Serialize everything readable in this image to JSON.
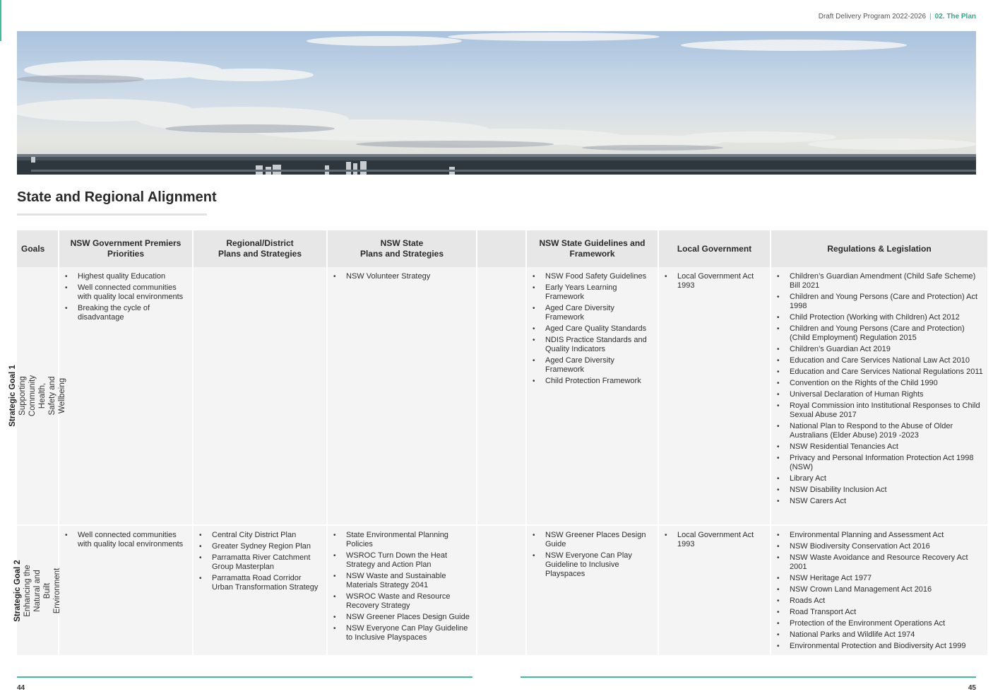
{
  "header": {
    "document_title": "Draft Delivery Program 2022-2026",
    "separator": "|",
    "section": "02. The Plan"
  },
  "banner": {
    "description_icon": "skyline-photo"
  },
  "page_title": "State and Regional Alignment",
  "table": {
    "headers": [
      "Goals",
      "NSW Government Premiers\nPriorities",
      "Regional/District\nPlans and Strategies",
      "NSW State\nPlans and Strategies",
      "",
      "NSW State Guidelines and\nFramework",
      "Local Government",
      "Regulations & Legislation"
    ],
    "rows": [
      {
        "goal_number": "Strategic Goal 1",
        "goal_name": "Supporting Community Health,\nSafety and Wellbeing",
        "premiers_priorities": [
          "Highest quality Education",
          "Well connected communities with quality local environments",
          "Breaking the cycle of disadvantage"
        ],
        "regional_plans": [],
        "state_plans": [
          "NSW Volunteer Strategy"
        ],
        "blank": [],
        "state_guidelines": [
          "NSW Food Safety Guidelines",
          "Early Years Learning Framework",
          "Aged Care Diversity Framework",
          "Aged Care Quality Standards",
          "NDIS Practice Standards and Quality Indicators",
          "Aged Care Diversity Framework",
          "Child Protection Framework"
        ],
        "local_government": [
          "Local Government Act 1993"
        ],
        "legislation": [
          "Children’s Guardian Amendment (Child Safe Scheme) Bill 2021",
          "Children and Young Persons (Care and Protection) Act 1998",
          "Child Protection (Working with Children) Act 2012",
          "Children and Young Persons (Care and Protection) (Child Employment) Regulation 2015",
          "Children’s Guardian Act 2019",
          "Education and Care Services National Law Act 2010",
          "Education and Care Services National Regulations 2011",
          "Convention on the Rights of the Child 1990",
          "Universal Declaration of Human Rights",
          "Royal Commission into Institutional Responses to Child Sexual Abuse 2017",
          "National Plan to Respond to the Abuse of Older Australians (Elder Abuse) 2019 -2023",
          "NSW Residential Tenancies Act",
          "Privacy and Personal Information Protection Act 1998 (NSW)",
          "Library Act",
          "NSW Disability Inclusion Act",
          "NSW Carers Act"
        ]
      },
      {
        "goal_number": "Strategic Goal 2",
        "goal_name": "Enhancing the Natural and\nBuilt Environment",
        "premiers_priorities": [
          "Well connected communities with quality local environments"
        ],
        "regional_plans": [
          "Central City District Plan",
          "Greater Sydney Region Plan",
          "Parramatta River Catchment Group Masterplan",
          "Parramatta Road Corridor Urban Transformation Strategy"
        ],
        "state_plans": [
          "State Environmental Planning Policies",
          "WSROC Turn Down the Heat Strategy and Action Plan",
          "NSW Waste and Sustainable Materials Strategy 2041",
          "WSROC Waste and Resource Recovery Strategy",
          "NSW Greener Places Design Guide",
          "NSW Everyone Can Play Guideline to Inclusive Playspaces"
        ],
        "blank": [],
        "state_guidelines": [
          "NSW Greener Places Design Guide",
          "NSW Everyone Can Play Guideline to Inclusive Playspaces"
        ],
        "local_government": [
          "Local Government Act 1993"
        ],
        "legislation": [
          "Environmental Planning and Assessment Act",
          "NSW Biodiversity Conservation Act 2016",
          "NSW Waste Avoidance and Resource Recovery Act 2001",
          "NSW Heritage Act 1977",
          "NSW Crown Land Management Act 2016",
          "Roads Act",
          "Road Transport Act",
          "Protection of the Environment Operations Act",
          "National Parks and Wildlife Act 1974",
          "Environmental Protection and Biodiversity Act  1999"
        ]
      }
    ]
  },
  "footer": {
    "page_left": "44",
    "page_right": "45"
  },
  "colors": {
    "accent": "#3dbf9f",
    "header_bg": "#e6e7e6",
    "cell_bg": "#f3f4f3"
  }
}
